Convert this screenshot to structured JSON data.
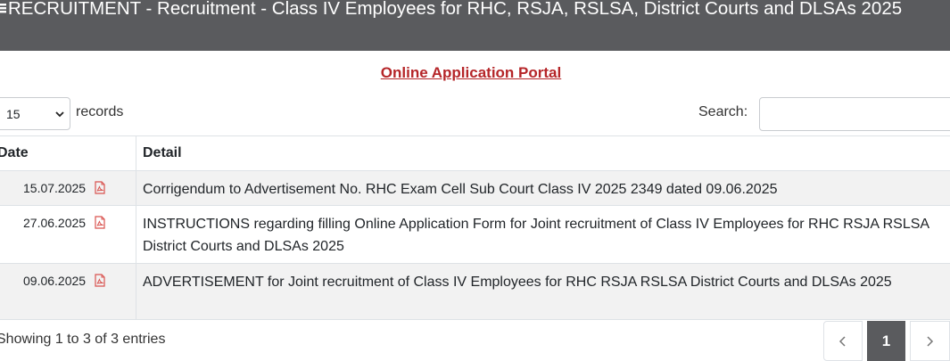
{
  "header": {
    "title": "RECRUITMENT - Recruitment - Class IV Employees for RHC, RSJA, RSLSA, District Courts and DLSAs 2025",
    "icon": "menu-icon"
  },
  "portal_link": "Online Application Portal",
  "length_menu": {
    "value": "15",
    "suffix": "records"
  },
  "search": {
    "label": "Search:",
    "value": "",
    "placeholder": ""
  },
  "table": {
    "columns": [
      "Date",
      "Detail"
    ],
    "rows": [
      {
        "date": "15.07.2025",
        "icon": "pdf-icon",
        "detail": "Corrigendum to Advertisement No. RHC Exam Cell Sub Court Class IV 2025 2349 dated 09.06.2025"
      },
      {
        "date": "27.06.2025",
        "icon": "pdf-icon",
        "detail": "INSTRUCTIONS regarding filling Online Application Form for Joint recruitment of Class IV Employees for RHC RSJA RSLSA District Courts and DLSAs 2025"
      },
      {
        "date": "09.06.2025",
        "icon": "pdf-icon",
        "detail": "ADVERTISEMENT for Joint recruitment of Class IV Employees for RHC RSJA RSLSA District Courts and DLSAs 2025"
      }
    ]
  },
  "info": "Showing 1 to 3 of 3 entries",
  "pagination": {
    "prev_icon": "chevron-left-icon",
    "current": "1",
    "next_icon": "chevron-right-icon"
  },
  "colors": {
    "header_bg": "#5a5b5e",
    "link": "#b52528",
    "pdf_icon": "#d9534f",
    "stripe": "#f2f2f2"
  }
}
